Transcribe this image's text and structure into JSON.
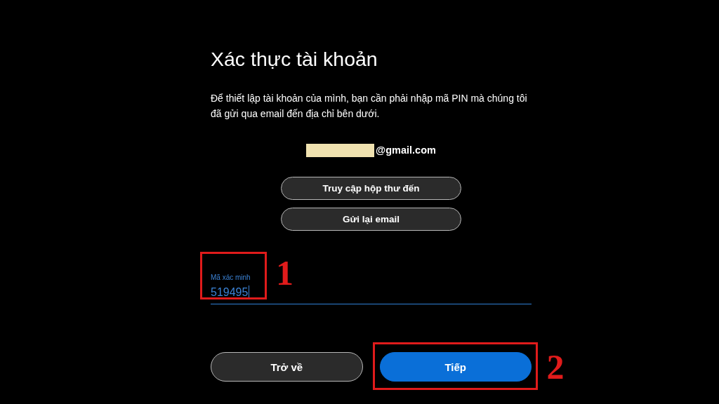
{
  "title": "Xác thực tài khoản",
  "message": "Để thiết lập tài khoản của mình, bạn cần phải nhập mã PIN mà chúng tôi đã gửi qua email đến địa chỉ bên dưới.",
  "email": {
    "redacted": true,
    "domain": "@gmail.com"
  },
  "links": [
    {
      "label": "Truy cập hộp thư đến"
    },
    {
      "label": "Gửi lại email"
    }
  ],
  "code_field": {
    "label": "Mã xác minh",
    "value": "519495",
    "focused": true,
    "annotation": "1"
  },
  "buttons": [
    {
      "label": "Trở về",
      "kind": "secondary"
    },
    {
      "label": "Tiếp",
      "kind": "primary",
      "annotation": "2"
    }
  ]
}
